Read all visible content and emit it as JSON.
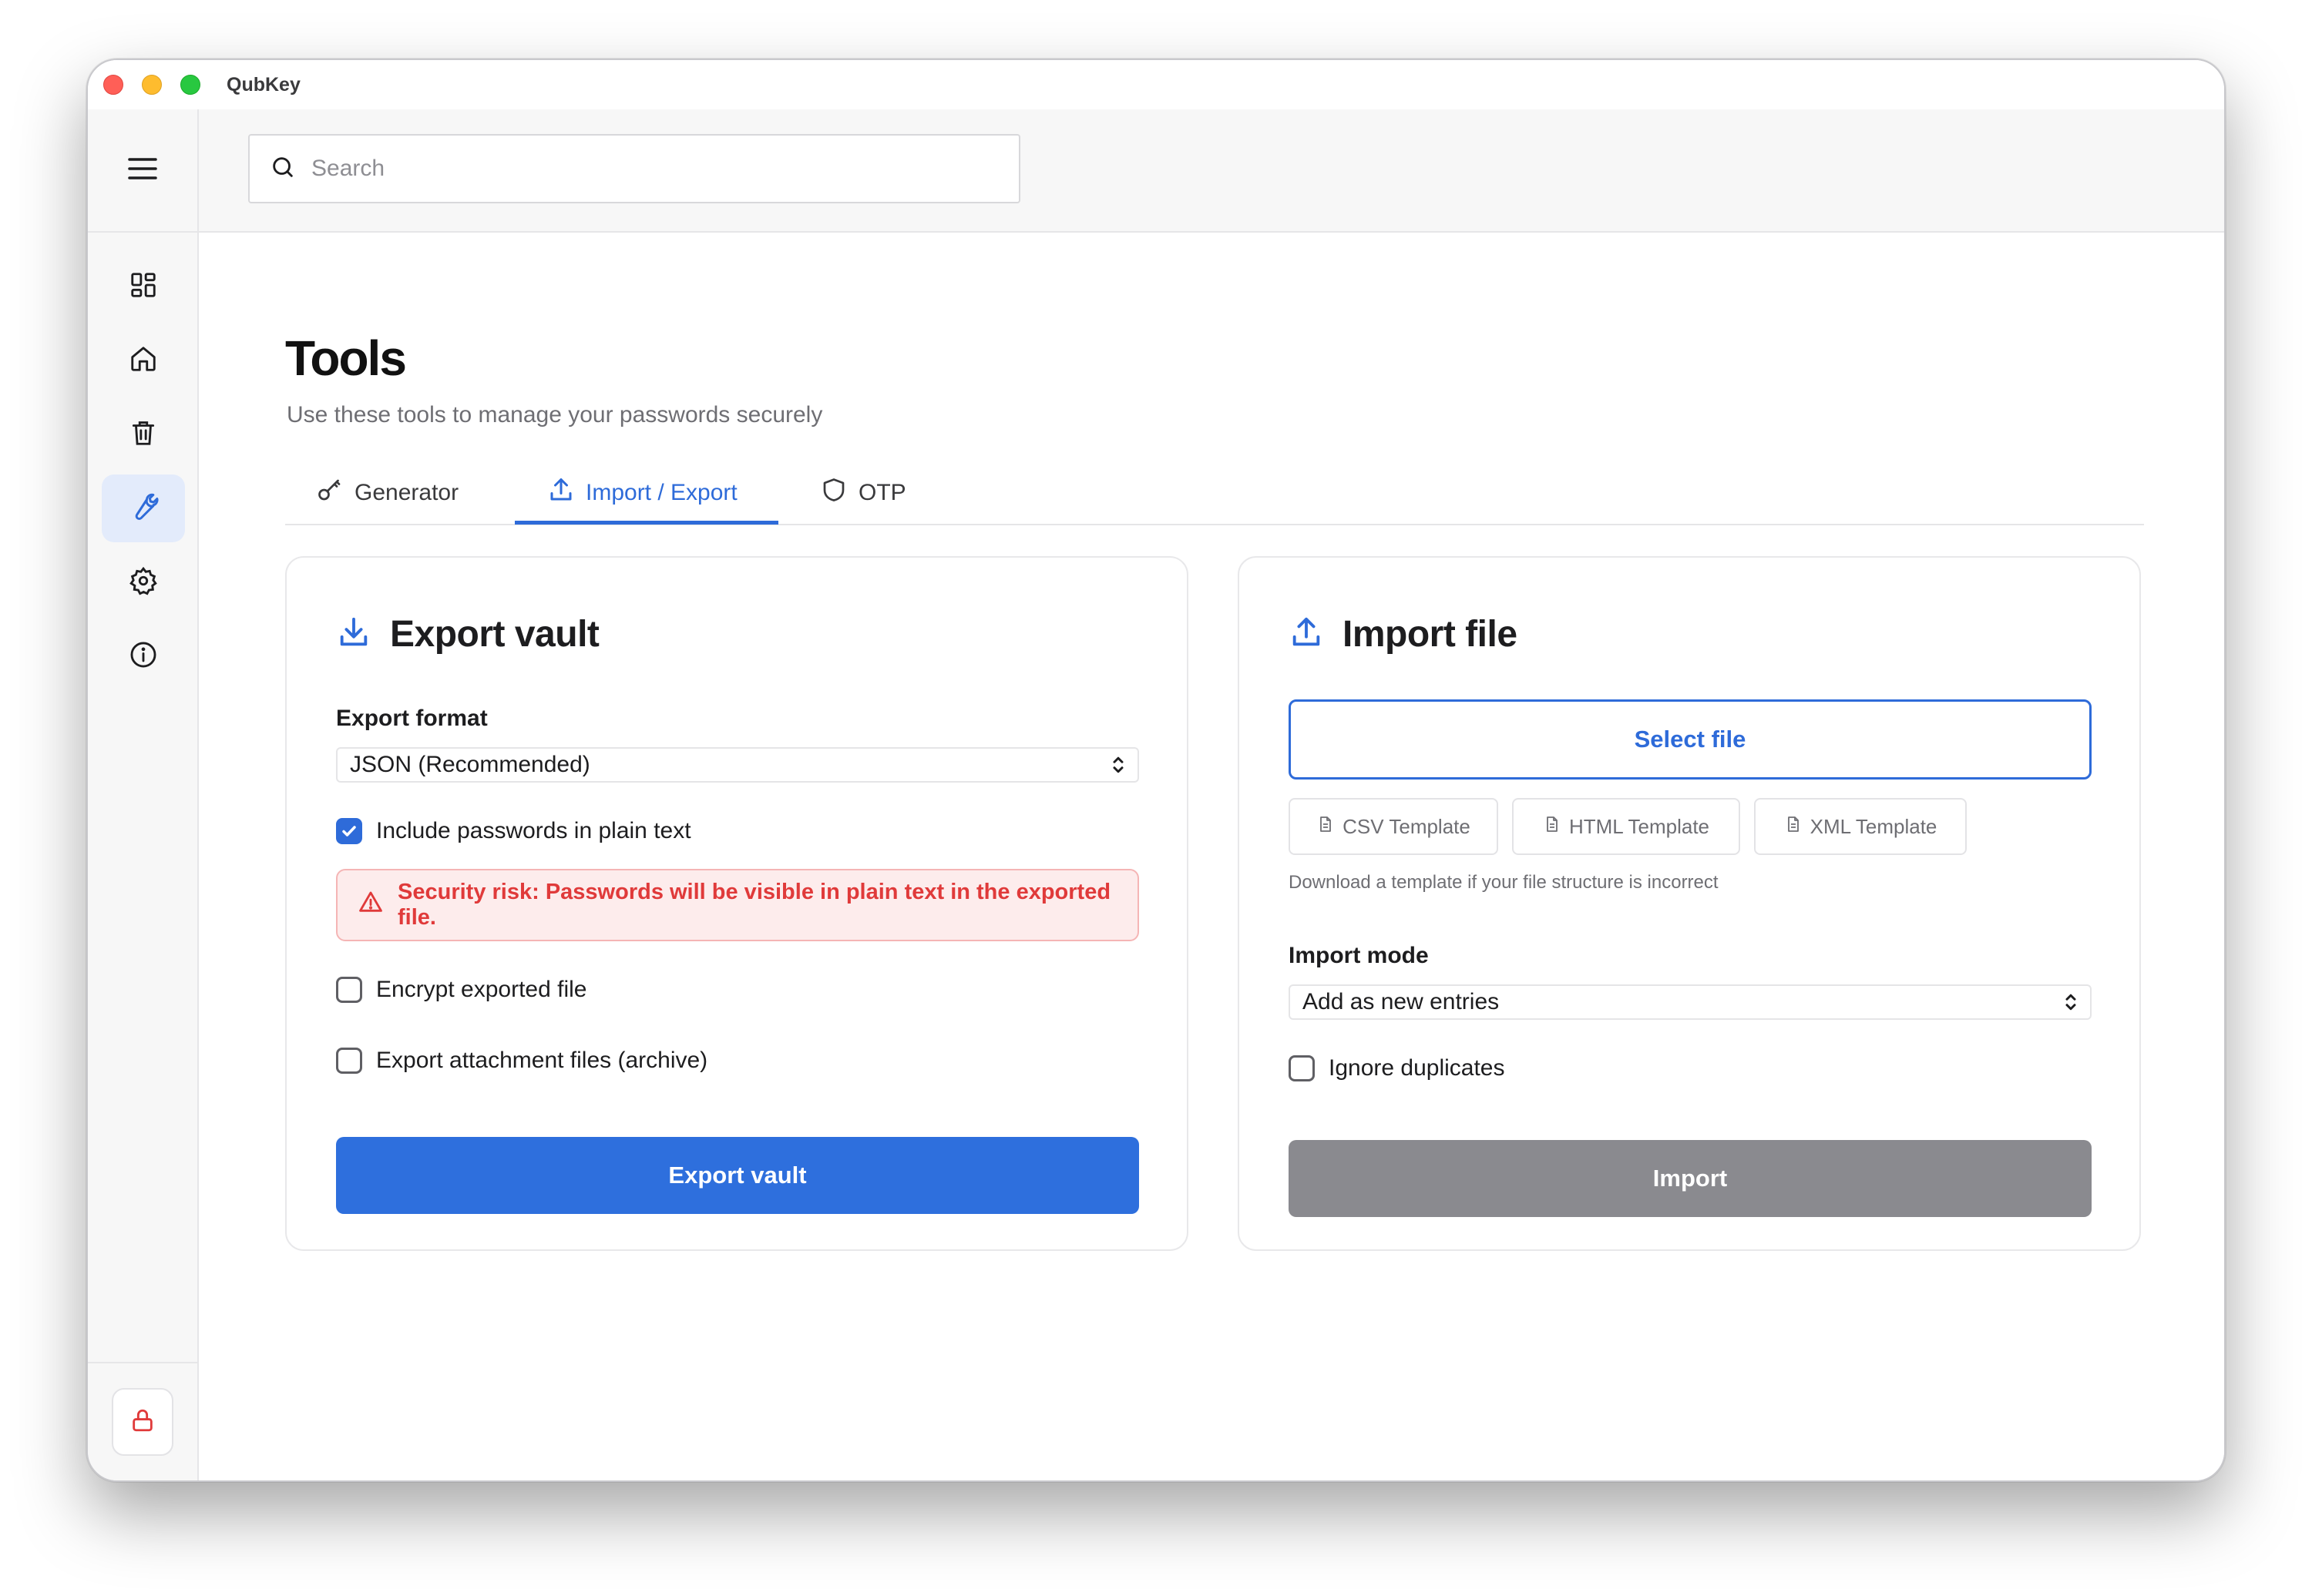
{
  "app": {
    "title": "QubKey"
  },
  "search": {
    "placeholder": "Search"
  },
  "sidebar": {
    "items": [
      {
        "name": "dashboard",
        "icon": "grid-icon"
      },
      {
        "name": "home",
        "icon": "home-icon"
      },
      {
        "name": "trash",
        "icon": "trash-icon"
      },
      {
        "name": "tools",
        "icon": "wrench-icon",
        "active": true
      },
      {
        "name": "settings",
        "icon": "gear-icon"
      },
      {
        "name": "about",
        "icon": "info-icon"
      }
    ],
    "lock_icon": "lock-icon"
  },
  "page": {
    "title": "Tools",
    "subtitle": "Use these tools to manage your passwords securely"
  },
  "tabs": [
    {
      "label": "Generator",
      "icon": "key-icon"
    },
    {
      "label": "Import / Export",
      "icon": "upload-icon",
      "active": true
    },
    {
      "label": "OTP",
      "icon": "shield-icon"
    }
  ],
  "export": {
    "title": "Export vault",
    "format_label": "Export format",
    "format_value": "JSON (Recommended)",
    "include_passwords_label": "Include passwords in plain text",
    "include_passwords_checked": true,
    "warning": "Security risk: Passwords will be visible in plain text in the exported file.",
    "encrypt_label": "Encrypt exported file",
    "encrypt_checked": false,
    "attachments_label": "Export attachment files (archive)",
    "attachments_checked": false,
    "button_label": "Export vault"
  },
  "import": {
    "title": "Import file",
    "select_file_label": "Select file",
    "templates": [
      "CSV Template",
      "HTML Template",
      "XML Template"
    ],
    "template_hint": "Download a template if your file structure is incorrect",
    "mode_label": "Import mode",
    "mode_value": "Add as new entries",
    "ignore_duplicates_label": "Ignore duplicates",
    "ignore_duplicates_checked": false,
    "button_label": "Import"
  },
  "colors": {
    "accent": "#2e6bd9",
    "danger": "#e03a3a",
    "disabled": "#8a8a8f"
  }
}
